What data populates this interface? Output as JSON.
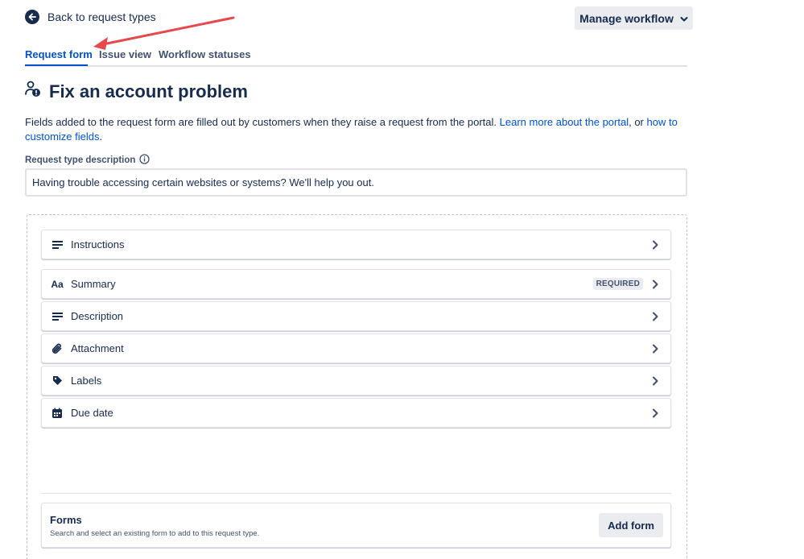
{
  "header": {
    "back_label": "Back to request types",
    "manage_label": "Manage workflow"
  },
  "tabs": [
    {
      "label": "Request form",
      "active": true
    },
    {
      "label": "Issue view",
      "active": false
    },
    {
      "label": "Workflow statuses",
      "active": false
    }
  ],
  "page": {
    "title": "Fix an account problem",
    "intro_text": "Fields added to the request form are filled out by customers when they raise a request from the portal.",
    "link_portal": "Learn more about the portal",
    "intro_or": ", or",
    "link_customize": "how to customize fields",
    "intro_end": "."
  },
  "description": {
    "label": "Request type description",
    "value": "Having trouble accessing certain websites or systems? We'll help you out."
  },
  "fields": [
    {
      "label": "Instructions",
      "icon": "lines-icon"
    },
    {
      "label": "Summary",
      "icon": "text-format-icon",
      "badge": "REQUIRED",
      "icon_text": "Aa"
    },
    {
      "label": "Description",
      "icon": "lines-icon"
    },
    {
      "label": "Attachment",
      "icon": "paperclip-icon"
    },
    {
      "label": "Labels",
      "icon": "tag-icon"
    },
    {
      "label": "Due date",
      "icon": "calendar-icon"
    }
  ],
  "forms": {
    "title": "Forms",
    "subtitle": "Search and select an existing form to add to this request type.",
    "button_label": "Add form"
  },
  "colors": {
    "primary": "#0052cc",
    "text": "#172b4d",
    "annotation_arrow": "#e5484d"
  }
}
